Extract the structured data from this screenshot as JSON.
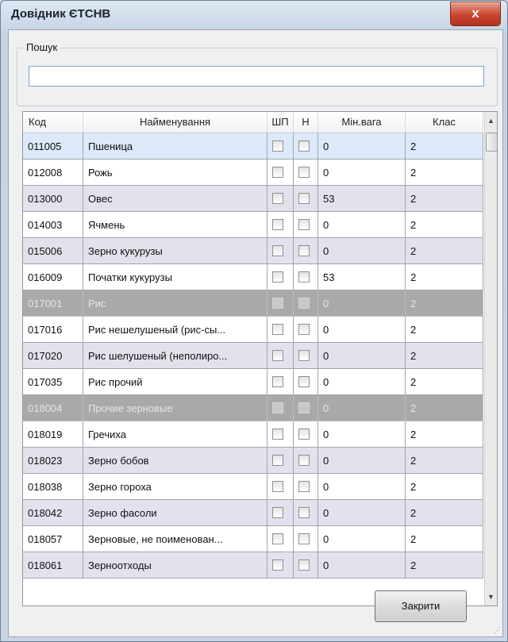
{
  "window": {
    "title": "Довідник ЄТСНВ",
    "close_glyph": "x"
  },
  "search": {
    "legend": "Пошук",
    "value": "",
    "placeholder": ""
  },
  "table": {
    "columns": [
      "Код",
      "Найменування",
      "ШП",
      "Н",
      "Мін.вага",
      "Клас"
    ],
    "rows": [
      {
        "code": "011005",
        "name": "Пшеница",
        "shp": false,
        "n": false,
        "min": "0",
        "cls": "2",
        "state": "selected"
      },
      {
        "code": "012008",
        "name": "Рожь",
        "shp": false,
        "n": false,
        "min": "0",
        "cls": "2",
        "state": "normal"
      },
      {
        "code": "013000",
        "name": "Овес",
        "shp": false,
        "n": false,
        "min": "53",
        "cls": "2",
        "state": "normal"
      },
      {
        "code": "014003",
        "name": "Ячмень",
        "shp": false,
        "n": false,
        "min": "0",
        "cls": "2",
        "state": "normal"
      },
      {
        "code": "015006",
        "name": "Зерно кукурузы",
        "shp": false,
        "n": false,
        "min": "0",
        "cls": "2",
        "state": "normal"
      },
      {
        "code": "016009",
        "name": "Початки кукурузы",
        "shp": false,
        "n": false,
        "min": "53",
        "cls": "2",
        "state": "normal"
      },
      {
        "code": "017001",
        "name": "Рис",
        "shp": false,
        "n": false,
        "min": "0",
        "cls": "2",
        "state": "disabled"
      },
      {
        "code": "017016",
        "name": "Рис нешелушеный (рис-сы...",
        "shp": false,
        "n": false,
        "min": "0",
        "cls": "2",
        "state": "normal"
      },
      {
        "code": "017020",
        "name": "Рис шелушеный (неполиро...",
        "shp": false,
        "n": false,
        "min": "0",
        "cls": "2",
        "state": "normal"
      },
      {
        "code": "017035",
        "name": "Рис прочий",
        "shp": false,
        "n": false,
        "min": "0",
        "cls": "2",
        "state": "normal"
      },
      {
        "code": "018004",
        "name": "Прочие зерновые",
        "shp": false,
        "n": false,
        "min": "0",
        "cls": "2",
        "state": "disabled"
      },
      {
        "code": "018019",
        "name": "Гречиха",
        "shp": false,
        "n": false,
        "min": "0",
        "cls": "2",
        "state": "normal"
      },
      {
        "code": "018023",
        "name": "Зерно бобов",
        "shp": false,
        "n": false,
        "min": "0",
        "cls": "2",
        "state": "normal"
      },
      {
        "code": "018038",
        "name": "Зерно гороха",
        "shp": false,
        "n": false,
        "min": "0",
        "cls": "2",
        "state": "normal"
      },
      {
        "code": "018042",
        "name": "Зерно фасоли",
        "shp": false,
        "n": false,
        "min": "0",
        "cls": "2",
        "state": "normal"
      },
      {
        "code": "018057",
        "name": "Зерновые, не поименован...",
        "shp": false,
        "n": false,
        "min": "0",
        "cls": "2",
        "state": "normal"
      },
      {
        "code": "018061",
        "name": "Зерноотходы",
        "shp": false,
        "n": false,
        "min": "0",
        "cls": "2",
        "state": "normal"
      }
    ]
  },
  "scrollbar": {
    "up_icon": "arrow-up-icon",
    "down_icon": "arrow-down-icon"
  },
  "buttons": {
    "close_label": "Закрити"
  },
  "colors": {
    "row_alt": "#e3e2ec",
    "row_selected": "#dbe9f8",
    "row_disabled": "#a9a9a9",
    "title_close": "#c9452f"
  }
}
